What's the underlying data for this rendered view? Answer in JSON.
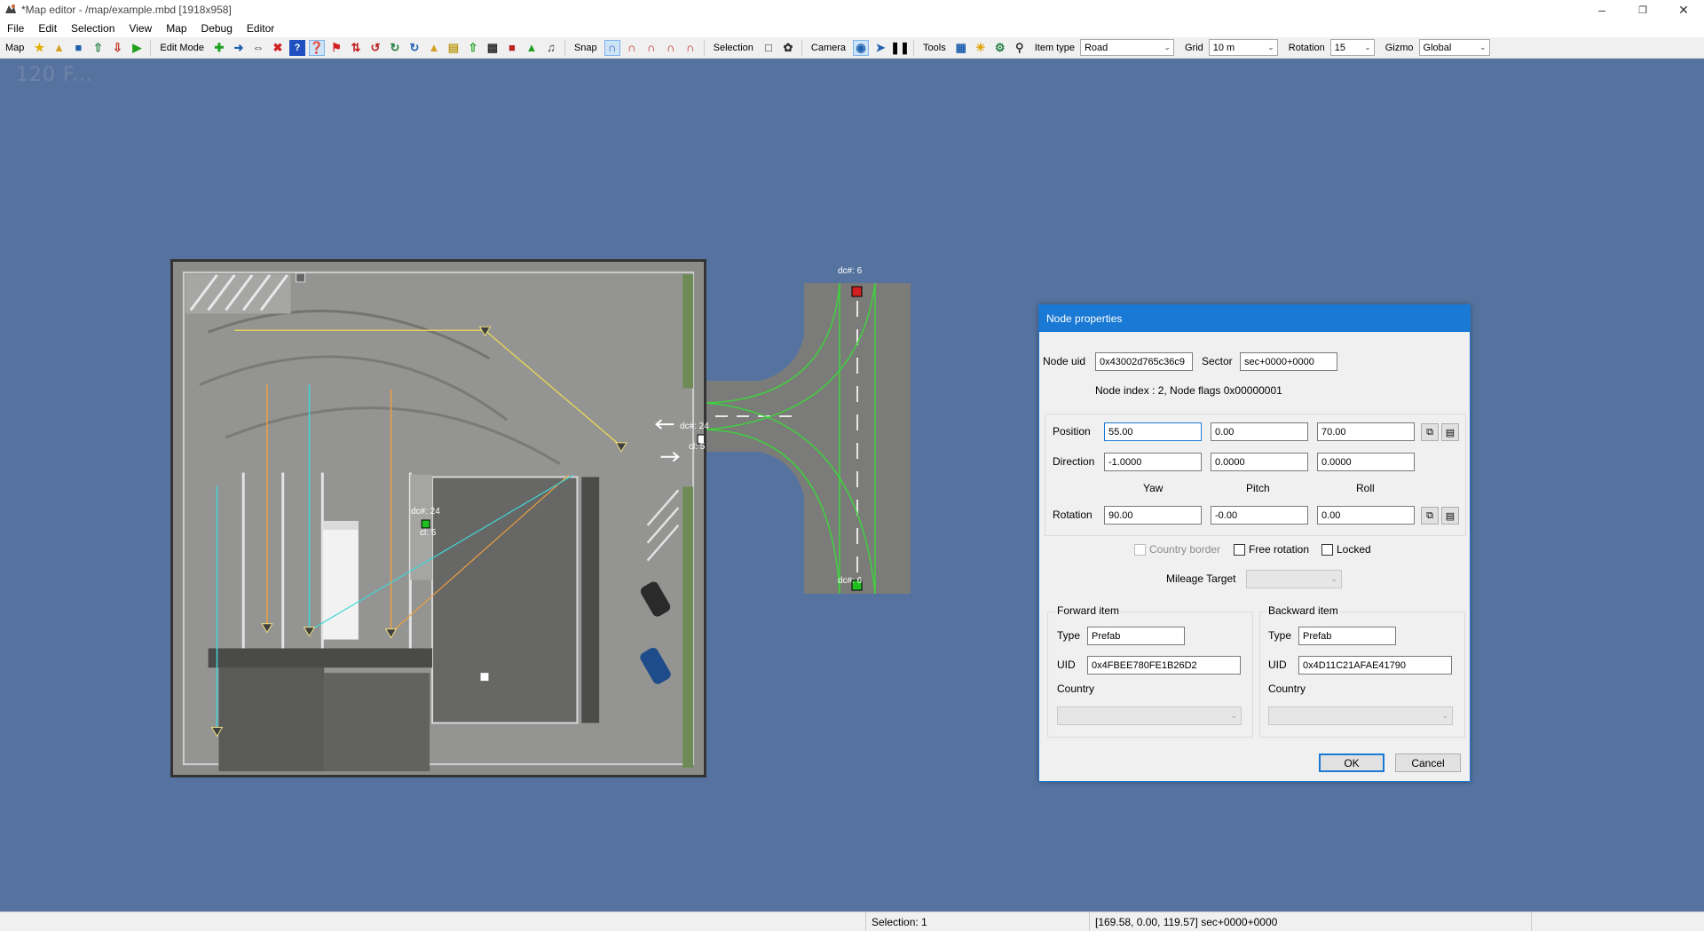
{
  "window": {
    "title": "*Map editor - /map/example.mbd [1918x958]",
    "controls": [
      "minimize-icon",
      "restore-icon",
      "close-icon"
    ]
  },
  "menu": [
    "File",
    "Edit",
    "Selection",
    "View",
    "Map",
    "Debug",
    "Editor"
  ],
  "toolbar": {
    "map_label": "Map",
    "edit_mode_label": "Edit Mode",
    "snap_label": "Snap",
    "selection_label": "Selection",
    "camera_label": "Camera",
    "tools_label": "Tools",
    "item_type_label": "Item type",
    "item_type_value": "Road",
    "grid_label": "Grid",
    "grid_value": "10 m",
    "rotation_label": "Rotation",
    "rotation_value": "15",
    "gizmo_label": "Gizmo",
    "gizmo_value": "Global"
  },
  "viewport": {
    "fps_text": "120 F...",
    "labels": {
      "node_top": "dc#: 6",
      "node_bottom": "dc#: 6",
      "node_mid": "dc#: 24",
      "node_mid_cl": "cl: 5",
      "node_lot": "dc#: 24",
      "node_lot_cl": "cl: 5"
    }
  },
  "dialog": {
    "title": "Node properties",
    "node_uid_label": "Node uid",
    "node_uid_value": "0x43002d765c36c9",
    "sector_label": "Sector",
    "sector_value": "sec+0000+0000",
    "node_info": "Node index : 2, Node flags 0x00000001",
    "position_label": "Position",
    "position": [
      "55.00",
      "0.00",
      "70.00"
    ],
    "direction_label": "Direction",
    "direction": [
      "-1.0000",
      "0.0000",
      "0.0000"
    ],
    "yaw_label": "Yaw",
    "pitch_label": "Pitch",
    "roll_label": "Roll",
    "rotation_label": "Rotation",
    "rotation": [
      "90.00",
      "-0.00",
      "0.00"
    ],
    "country_border_label": "Country border",
    "free_rotation_label": "Free rotation",
    "locked_label": "Locked",
    "mileage_target_label": "Mileage Target",
    "forward": {
      "title": "Forward item",
      "type_label": "Type",
      "type_value": "Prefab",
      "uid_label": "UID",
      "uid_value": "0x4FBEE780FE1B26D2",
      "country_label": "Country"
    },
    "backward": {
      "title": "Backward item",
      "type_label": "Type",
      "type_value": "Prefab",
      "uid_label": "UID",
      "uid_value": "0x4D11C21AFAE41790",
      "country_label": "Country"
    },
    "ok_label": "OK",
    "cancel_label": "Cancel"
  },
  "status": {
    "selection": "Selection: 1",
    "coords": "[169.58, 0.00, 119.57] sec+0000+0000"
  }
}
